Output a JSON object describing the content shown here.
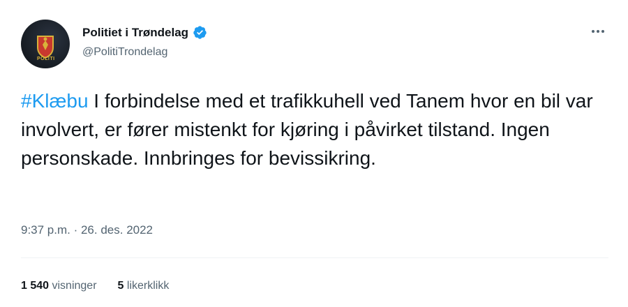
{
  "author": {
    "display_name": "Politiet i Trøndelag",
    "handle": "@PolitiTrondelag",
    "verified": true,
    "avatar_badge_text": "POLITI"
  },
  "tweet": {
    "hashtag": "#Klæbu",
    "body": " I forbindelse med et trafikkuhell ved Tanem hvor en bil var involvert, er fører mistenkt for kjøring i påvirket tilstand. Ingen personskade. Innbringes for bevissikring.",
    "timestamp": "9:37 p.m. · 26. des. 2022"
  },
  "stats": {
    "views_value": "1 540",
    "views_label": "visninger",
    "likes_value": "5",
    "likes_label": "likerklikk"
  },
  "icons": {
    "more": "more-icon",
    "verified": "verified-badge-icon"
  },
  "colors": {
    "link": "#1d9bf0",
    "secondary_text": "#536471",
    "primary_text": "#0f1419",
    "verified": "#1d9bf0"
  }
}
